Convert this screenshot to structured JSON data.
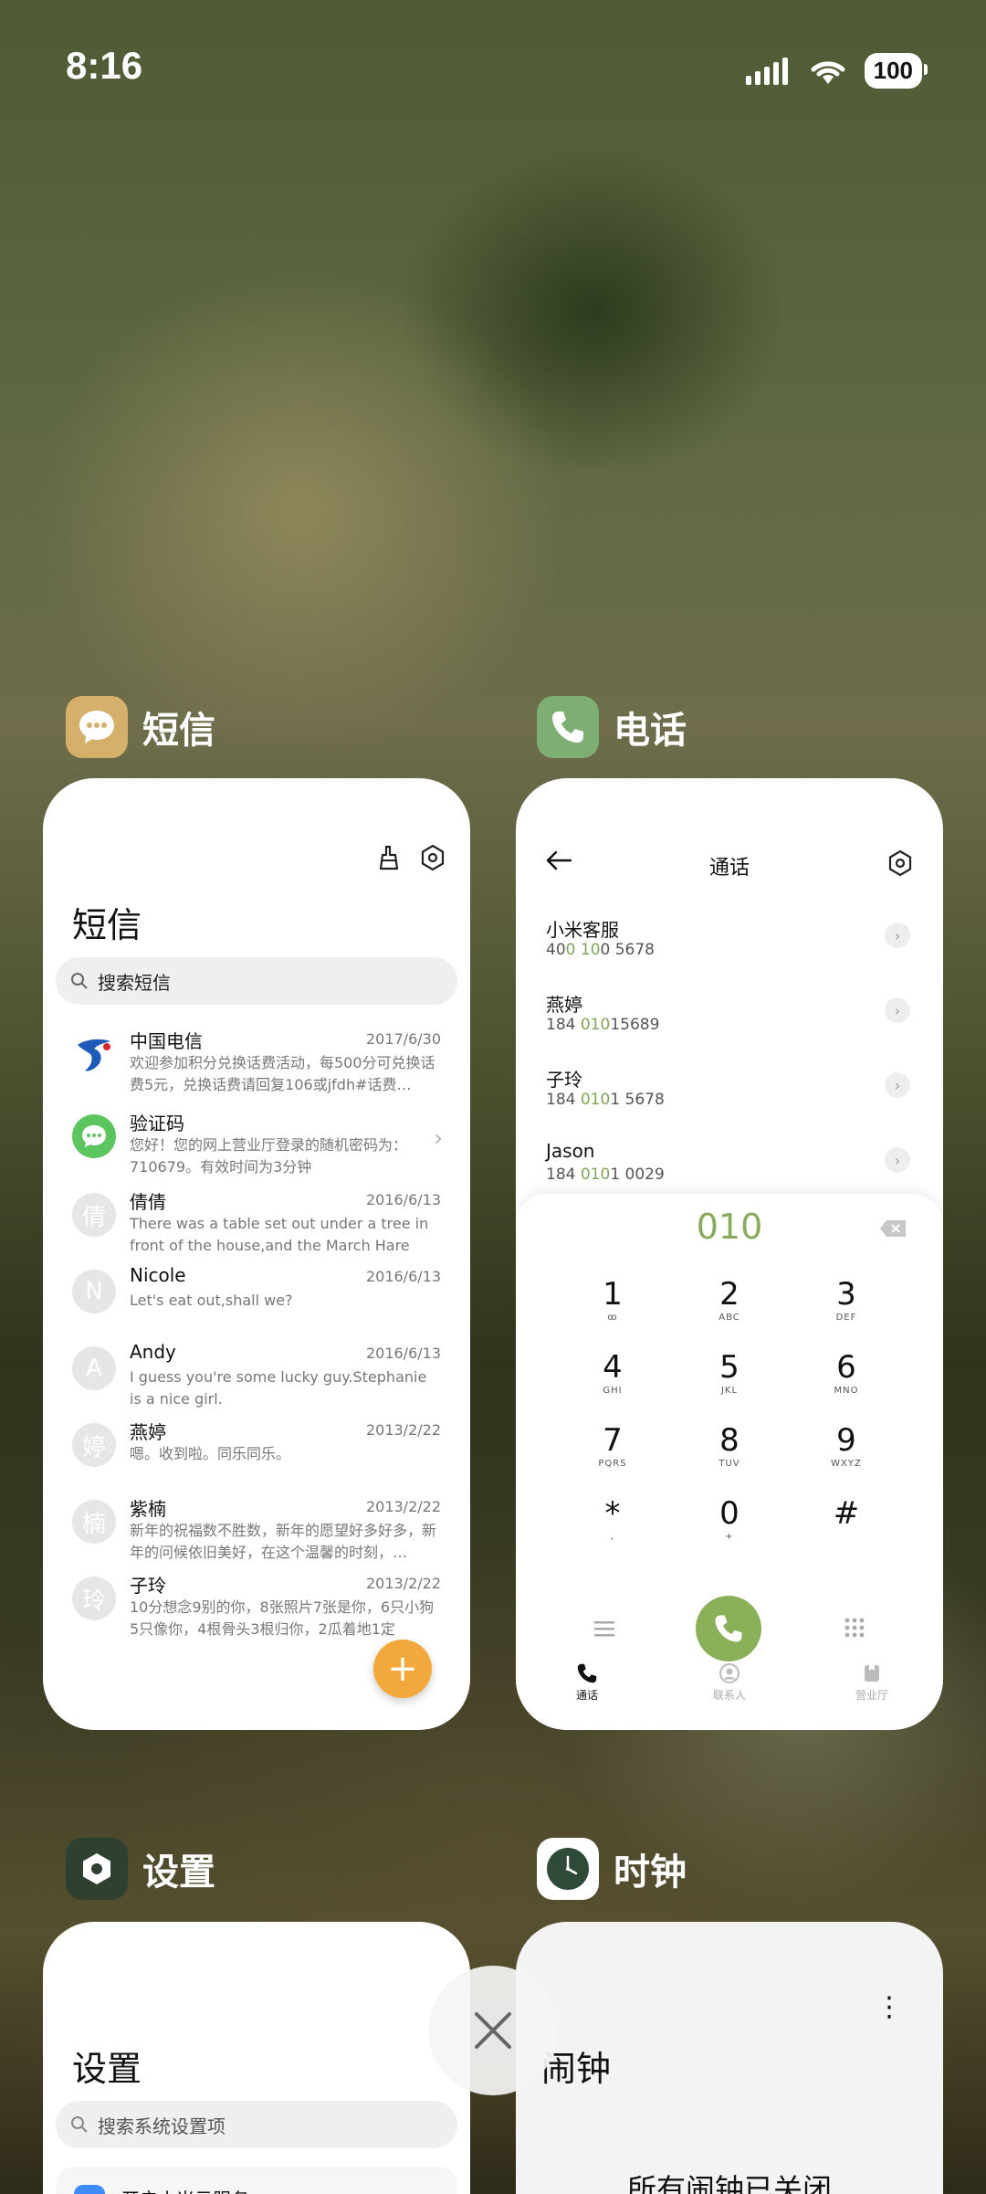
{
  "status": {
    "time": "8:16",
    "battery": "100"
  },
  "apps": {
    "sms": {
      "app_name": "短信",
      "title": "短信",
      "search_placeholder": "搜索短信",
      "icon_color": "#d4b06a",
      "messages": [
        {
          "name": "中国电信",
          "date": "2017/6/30",
          "text": "欢迎参加积分兑换话费活动，每500分可兑换话费5元，兑换话费请回复106或jfdh#话费…",
          "avatar": ""
        },
        {
          "name": "验证码",
          "date": "",
          "text": "您好！您的网上营业厅登录的随机密码为：710679。有效时间为3分钟",
          "avatar": ""
        },
        {
          "name": "倩倩",
          "date": "2016/6/13",
          "text": "There was a table set out under a tree in front of the house,and the March Hare an…",
          "avatar": "倩"
        },
        {
          "name": "Nicole",
          "date": "2016/6/13",
          "text": "Let's eat out,shall we?",
          "avatar": "N"
        },
        {
          "name": "Andy",
          "date": "2016/6/13",
          "text": "I guess you're some lucky guy.Stephanie is a nice girl.",
          "avatar": "A"
        },
        {
          "name": "燕婷",
          "date": "2013/2/22",
          "text": "嗯。收到啦。同乐同乐。",
          "avatar": "婷"
        },
        {
          "name": "紫楠",
          "date": "2013/2/22",
          "text": "新年的祝福数不胜数，新年的愿望好多好多，新年的问候依旧美好，在这个温馨的时刻，…",
          "avatar": "楠"
        },
        {
          "name": "子玲",
          "date": "2013/2/22",
          "text": "10分想念9别的你，8张照片7张是你，6只小狗5只像你，4根骨头3根归你，2瓜着地1定",
          "avatar": "玲"
        }
      ],
      "fab": "+"
    },
    "phone": {
      "app_name": "电话",
      "title": "通话",
      "icon_color": "#7fae72",
      "contacts": [
        {
          "name": "小米客服",
          "pre": "40",
          "hl1": "0",
          "mid": " ",
          "hl2": "10",
          "post": "0 5678"
        },
        {
          "name": "燕婷",
          "pre": "184 ",
          "hl1": "010",
          "mid": "",
          "hl2": "",
          "post": "15689"
        },
        {
          "name": "子玲",
          "pre": "184 ",
          "hl1": "010",
          "mid": "",
          "hl2": "",
          "post": "1 5678"
        },
        {
          "name": "Jason",
          "pre": "184 ",
          "hl1": "010",
          "mid": "",
          "hl2": "",
          "post": "1 0029"
        }
      ],
      "dialed": "010",
      "keys": [
        {
          "d": "1",
          "l": "ꝏ"
        },
        {
          "d": "2",
          "l": "ABC"
        },
        {
          "d": "3",
          "l": "DEF"
        },
        {
          "d": "4",
          "l": "GHI"
        },
        {
          "d": "5",
          "l": "JKL"
        },
        {
          "d": "6",
          "l": "MNO"
        },
        {
          "d": "7",
          "l": "PQRS"
        },
        {
          "d": "8",
          "l": "TUV"
        },
        {
          "d": "9",
          "l": "WXYZ"
        },
        {
          "d": "*",
          "l": ","
        },
        {
          "d": "0",
          "l": "+"
        },
        {
          "d": "#",
          "l": ""
        }
      ],
      "tabs": [
        "通话",
        "联系人",
        "营业厅"
      ],
      "accent": "#8ab05a"
    },
    "settings": {
      "app_name": "设置",
      "title": "设置",
      "search_placeholder": "搜索系统设置项",
      "first_row": "开启小米云服务"
    },
    "clock": {
      "app_name": "时钟",
      "title": "闹钟",
      "empty_text": "所有闹钟已关闭"
    }
  }
}
